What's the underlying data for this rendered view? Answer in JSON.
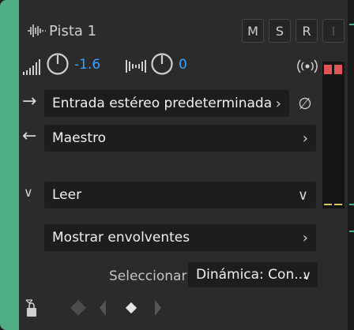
{
  "track": {
    "name": "Pista 1",
    "buttons": {
      "mute": "M",
      "solo": "S",
      "record": "R",
      "input": "I"
    },
    "volume_value": "-1.6",
    "pan_value": "0",
    "input_label": "Entrada estéreo predeterminada",
    "output_label": "Maestro",
    "automation_mode": "Leer",
    "envelopes_label": "Mostrar envolventes",
    "select_label": "Seleccionar:",
    "select_value": "Dinámica: Con..."
  },
  "colors": {
    "track": "#4fae86",
    "value": "#3aa0ff",
    "clip": "#e05656",
    "meter_line": "#d6c65a"
  },
  "icons": [
    "waveform-icon",
    "volume-icon",
    "knob-icon",
    "pan-icon",
    "monitor-icon",
    "input-arrow-icon",
    "output-arrow-icon",
    "phase-icon",
    "expand-chevron-icon",
    "lock-icon",
    "diamond-icon",
    "prev-keyframe-icon",
    "add-keyframe-icon",
    "next-keyframe-icon"
  ]
}
